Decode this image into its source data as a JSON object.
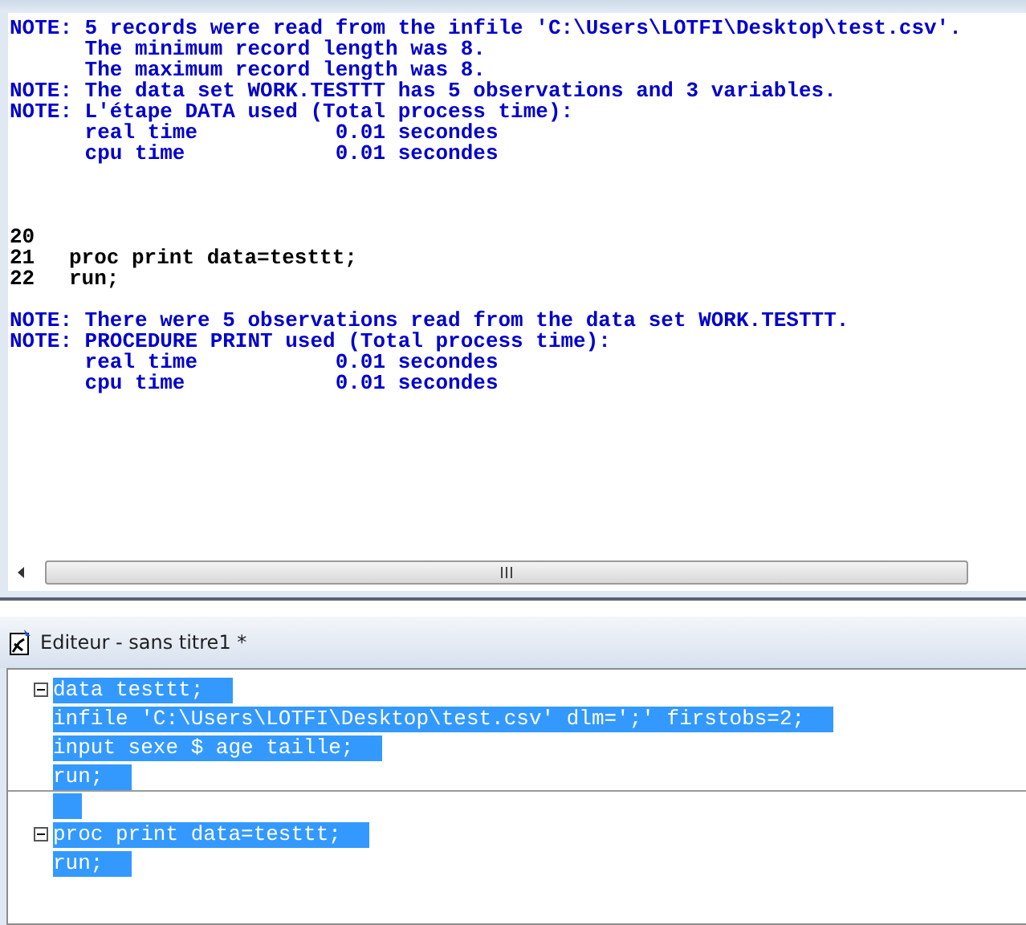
{
  "log": {
    "lines": [
      {
        "kind": "note",
        "text": "NOTE: 5 records were read from the infile 'C:\\Users\\LOTFI\\Desktop\\test.csv'."
      },
      {
        "kind": "note",
        "text": "      The minimum record length was 8."
      },
      {
        "kind": "note",
        "text": "      The maximum record length was 8."
      },
      {
        "kind": "note",
        "text": "NOTE: The data set WORK.TESTTT has 5 observations and 3 variables."
      },
      {
        "kind": "note",
        "text": "NOTE: L'étape DATA used (Total process time):"
      },
      {
        "kind": "note",
        "text": "      real time           0.01 secondes"
      },
      {
        "kind": "note",
        "text": "      cpu time            0.01 secondes"
      },
      {
        "kind": "blank"
      },
      {
        "kind": "blank"
      },
      {
        "kind": "blank"
      },
      {
        "kind": "source",
        "number": "20"
      },
      {
        "kind": "source",
        "number": "21",
        "text": "proc print data=testtt;"
      },
      {
        "kind": "source",
        "number": "22",
        "text": "run;"
      },
      {
        "kind": "blank"
      },
      {
        "kind": "note",
        "text": "NOTE: There were 5 observations read from the data set WORK.TESTTT."
      },
      {
        "kind": "note",
        "text": "NOTE: PROCEDURE PRINT used (Total process time):"
      },
      {
        "kind": "note",
        "text": "      real time           0.01 secondes"
      },
      {
        "kind": "note",
        "text": "      cpu time            0.01 secondes"
      }
    ]
  },
  "editor": {
    "title": "Editeur - sans titre1 *",
    "lines": [
      {
        "kind": "code",
        "text": "data testtt;",
        "collapsible": true,
        "block_end": false,
        "selected": true
      },
      {
        "kind": "code",
        "text": "infile 'C:\\Users\\LOTFI\\Desktop\\test.csv' dlm=';' firstobs=2;",
        "collapsible": false,
        "block_end": false,
        "selected": true
      },
      {
        "kind": "code",
        "text": "input sexe $ age taille;",
        "collapsible": false,
        "block_end": false,
        "selected": true
      },
      {
        "kind": "code",
        "text": "run;",
        "collapsible": false,
        "block_end": true,
        "selected": true
      },
      {
        "kind": "blank",
        "selected": true
      },
      {
        "kind": "code",
        "text": "proc print data=testtt;",
        "collapsible": true,
        "block_end": false,
        "selected": true
      },
      {
        "kind": "code",
        "text": "run;",
        "collapsible": false,
        "block_end": false,
        "selected": true
      }
    ]
  }
}
